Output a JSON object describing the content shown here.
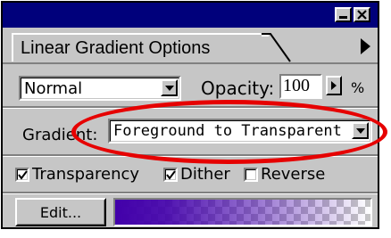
{
  "window": {
    "tab_title": "Linear Gradient Options"
  },
  "blend": {
    "mode_value": "Normal",
    "opacity_label": "Opacity:",
    "opacity_value": "100",
    "percent_symbol": "%"
  },
  "gradient": {
    "label": "Gradient:",
    "value": "Foreground to Transparent",
    "preview_start_color": "#4200aa",
    "preview_end": "transparent"
  },
  "options": {
    "transparency_label": "Transparency",
    "transparency_checked": true,
    "dither_label": "Dither",
    "dither_checked": true,
    "reverse_label": "Reverse",
    "reverse_checked": false
  },
  "actions": {
    "edit_label": "Edit..."
  },
  "annotation": {
    "color": "#e60000",
    "shape": "ellipse",
    "highlights": "gradient-select"
  },
  "icons": [
    "minimize-icon",
    "close-icon",
    "palette-menu-arrow-icon",
    "dropdown-arrow-icon",
    "opacity-slider-arrow-icon",
    "checkmark-icon"
  ]
}
